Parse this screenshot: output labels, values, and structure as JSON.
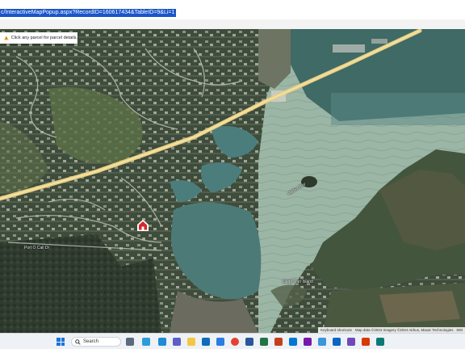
{
  "browser": {
    "url": "c/InteractiveMapPopup.aspx?RecordID=160617434&TableID=9&Li=1"
  },
  "map": {
    "banner_text": "Click any parcel for parcel details.",
    "labels": {
      "port_o_call": "Port O Call Dr",
      "lake_label": "Harbor Bay",
      "island_label": "Dead Man Island"
    },
    "attribution": {
      "keyboard": "Keyboard shortcuts",
      "data": "Map data ©2024 Imagery ©2024 Airbus, Maxar Technologies",
      "scale": "500"
    },
    "colors": {
      "marker": "#d9262b",
      "highway": "#f1d58a",
      "lake_light": "#9fb8a8",
      "lake_dark": "#3f6a66",
      "land": "#44553e"
    }
  },
  "taskbar": {
    "search_placeholder": "Search",
    "icons": [
      "windows-start-icon",
      "search-icon",
      "task-view-icon",
      "widgets-icon",
      "edge-icon",
      "teams-icon",
      "file-explorer-icon",
      "outlook-icon",
      "store-icon",
      "chrome-icon",
      "word-icon",
      "excel-icon",
      "powerpoint-icon",
      "mail-icon",
      "onenote-icon",
      "photos-icon"
    ]
  }
}
